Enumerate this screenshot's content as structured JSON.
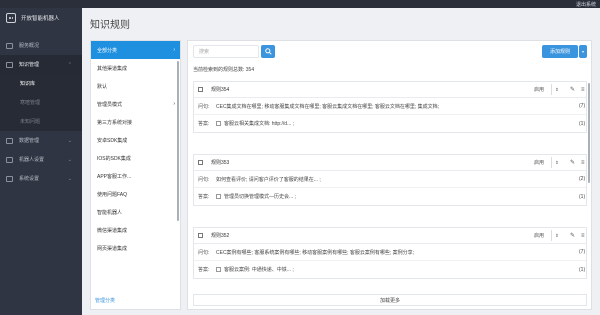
{
  "topbar": {
    "exit_label": "退出系统"
  },
  "brand": {
    "name": "开放智能机器人"
  },
  "sidebar": {
    "items": [
      {
        "label": "服务概况",
        "icon": "chart-icon"
      },
      {
        "label": "知识管理",
        "icon": "book-icon",
        "arrow": "⌃"
      },
      {
        "label": "数据管理",
        "icon": "data-icon",
        "arrow": "⌄"
      },
      {
        "label": "机器人设置",
        "icon": "robot-icon",
        "arrow": "⌄"
      },
      {
        "label": "系统设置",
        "icon": "gear-icon",
        "arrow": "⌄"
      }
    ],
    "subitems": [
      "知识库",
      "寒暄管理",
      "未知问题"
    ]
  },
  "page": {
    "title": "知识规则"
  },
  "categories": {
    "items": [
      "全部分类",
      "其他渠道集成",
      "默认",
      "管理员模式",
      "第三方系统对接",
      "安卓SDK集成",
      "IOS的SDK集成",
      "APP客服工作...",
      "使用问题FAQ",
      "智能机器人",
      "微信渠道集成",
      "网页渠道集成"
    ],
    "footer": "管理分类"
  },
  "search": {
    "placeholder": "搜索",
    "icon": "search-icon"
  },
  "toolbar": {
    "add_label": "添加规则"
  },
  "total": {
    "label": "当前检索到的规则总数: 354"
  },
  "cards": [
    {
      "name": "规则354",
      "status": "启用",
      "question": "CEC集成文档在哪里;  移动客服集成文档在哪里;  客服云集成文档在哪里;  客服云文档在哪里;  集成文档;",
      "question_count": "(7)",
      "answer": "客服云相关集成文档: http://d... ;",
      "answer_count": "(1)"
    },
    {
      "name": "规则353",
      "status": "启用",
      "question": "如何查看评价;  请问客户评价了客服的结果在... ;",
      "question_count": "(2)",
      "answer": "管理员切换管理模式—历史会... ;",
      "answer_count": "(1)"
    },
    {
      "name": "规则352",
      "status": "启用",
      "question": "CEC案例有哪些;  客服系统案例有哪些;  移动客服案例有哪些;  客服云案例有哪些;  案例分享;",
      "question_count": "(7)",
      "answer": "客服云案例: 中通快递、中铁... ;",
      "answer_count": "(1)"
    }
  ],
  "labels": {
    "question": "问句:",
    "answer": "答案:"
  },
  "load_more": "加载更多",
  "colors": {
    "accent": "#1e90df",
    "sidebar": "#2f3542"
  }
}
